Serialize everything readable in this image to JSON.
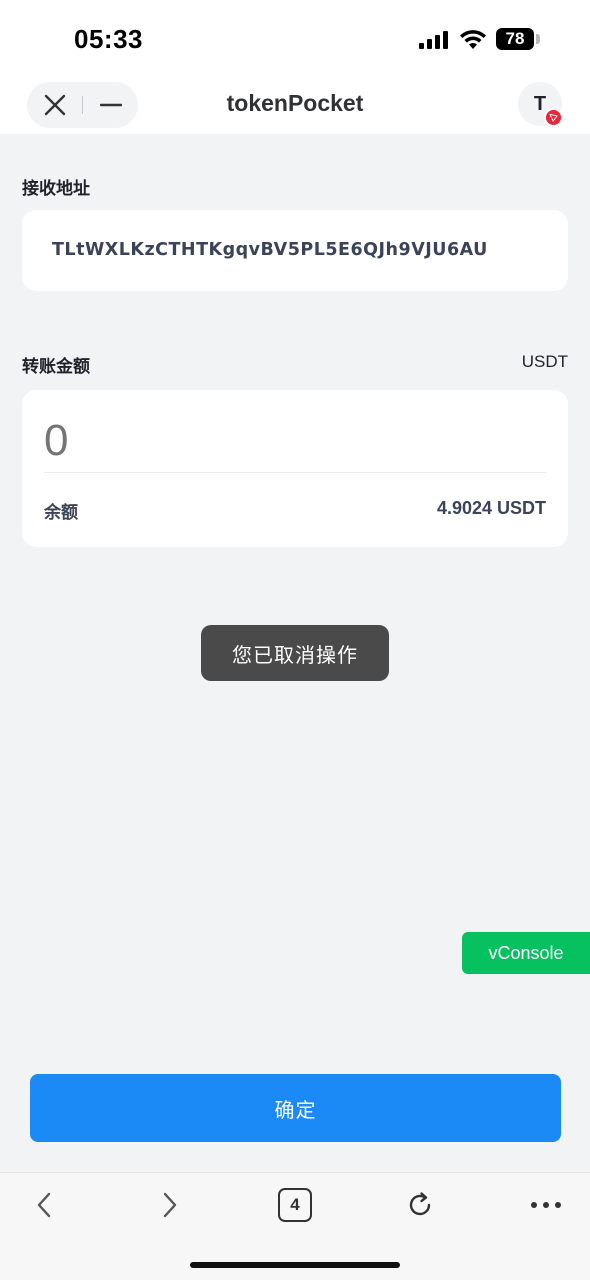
{
  "status_bar": {
    "time": "05:33",
    "battery": "78"
  },
  "header": {
    "title": "tokenPocket",
    "avatar_letter": "T"
  },
  "receive": {
    "label": "接收地址",
    "address": "TLtWXLKzCTHTKgqvBV5PL5E6QJh9VJU6AU"
  },
  "transfer": {
    "label": "转账金额",
    "currency": "USDT",
    "amount_placeholder": "0",
    "balance_label": "余额",
    "balance_value": "4.9024 USDT"
  },
  "toast": {
    "text": "您已取消操作"
  },
  "vconsole": {
    "label": "vConsole"
  },
  "confirm": {
    "label": "确定"
  },
  "toolbar": {
    "tab_count": "4"
  },
  "colors": {
    "primary": "#1b8af7",
    "vconsole": "#07c160",
    "toast_bg": "#4a4a4a",
    "badge": "#e5283a"
  }
}
